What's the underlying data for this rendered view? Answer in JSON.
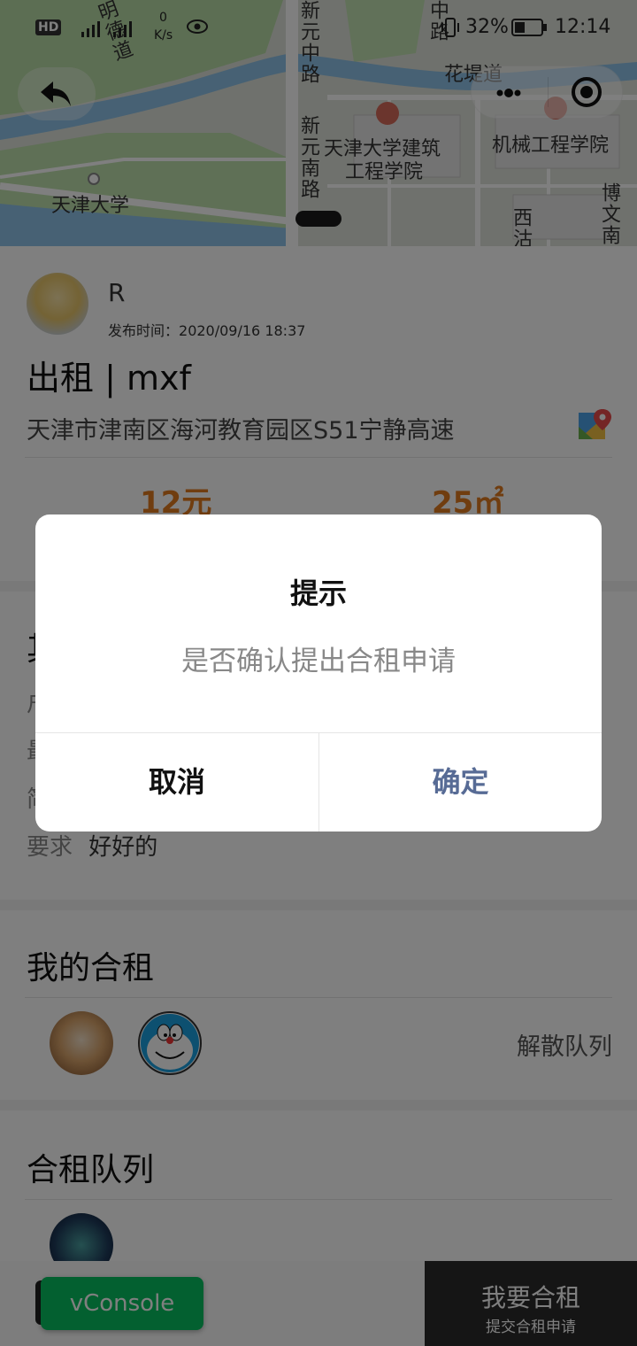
{
  "status_bar": {
    "hd_badge": "HD",
    "net_speed_value": "0",
    "net_speed_unit": "K/s",
    "battery": "32%",
    "time": "12:14"
  },
  "map": {
    "labels": {
      "tianjin_univ": "天津大学",
      "arch_school_line1": "天津大学建筑",
      "arch_school_line2": "工程学院",
      "mech_school": "机械工程学院",
      "road_xinyuan_zhong": "新元中路",
      "road_xinyuan_nan": "新元南路",
      "road_huadi": "花堤道",
      "road_zhong": "中路",
      "road_bowen": "博文南",
      "road_xi": "西沽",
      "road_ming": "明德道"
    }
  },
  "listing": {
    "poster_name": "R",
    "publish_label": "发布时间：",
    "publish_time": "2020/09/16 18:37",
    "title": "出租 | mxf",
    "address": "天津市津南区海河教育园区S51宁静高速",
    "price": "12元",
    "area": "25㎡"
  },
  "details": {
    "section_title_partial": "其",
    "row1_partial": "户",
    "row2_partial": "最",
    "row3_partial": "简",
    "requirement_label": "要求",
    "requirement_value": "好好的"
  },
  "my_group": {
    "title": "我的合租",
    "dissolve_label": "解散队列"
  },
  "queue": {
    "title": "合租队列"
  },
  "bottom": {
    "primary_label": "我要合租",
    "primary_sub": "提交合租申请",
    "vconsole": "vConsole"
  },
  "dialog": {
    "title": "提示",
    "message": "是否确认提出合租申请",
    "cancel": "取消",
    "confirm": "确定"
  },
  "colors": {
    "price": "#e07b1e",
    "confirm_text": "#576b95",
    "vconsole": "#07c160"
  }
}
